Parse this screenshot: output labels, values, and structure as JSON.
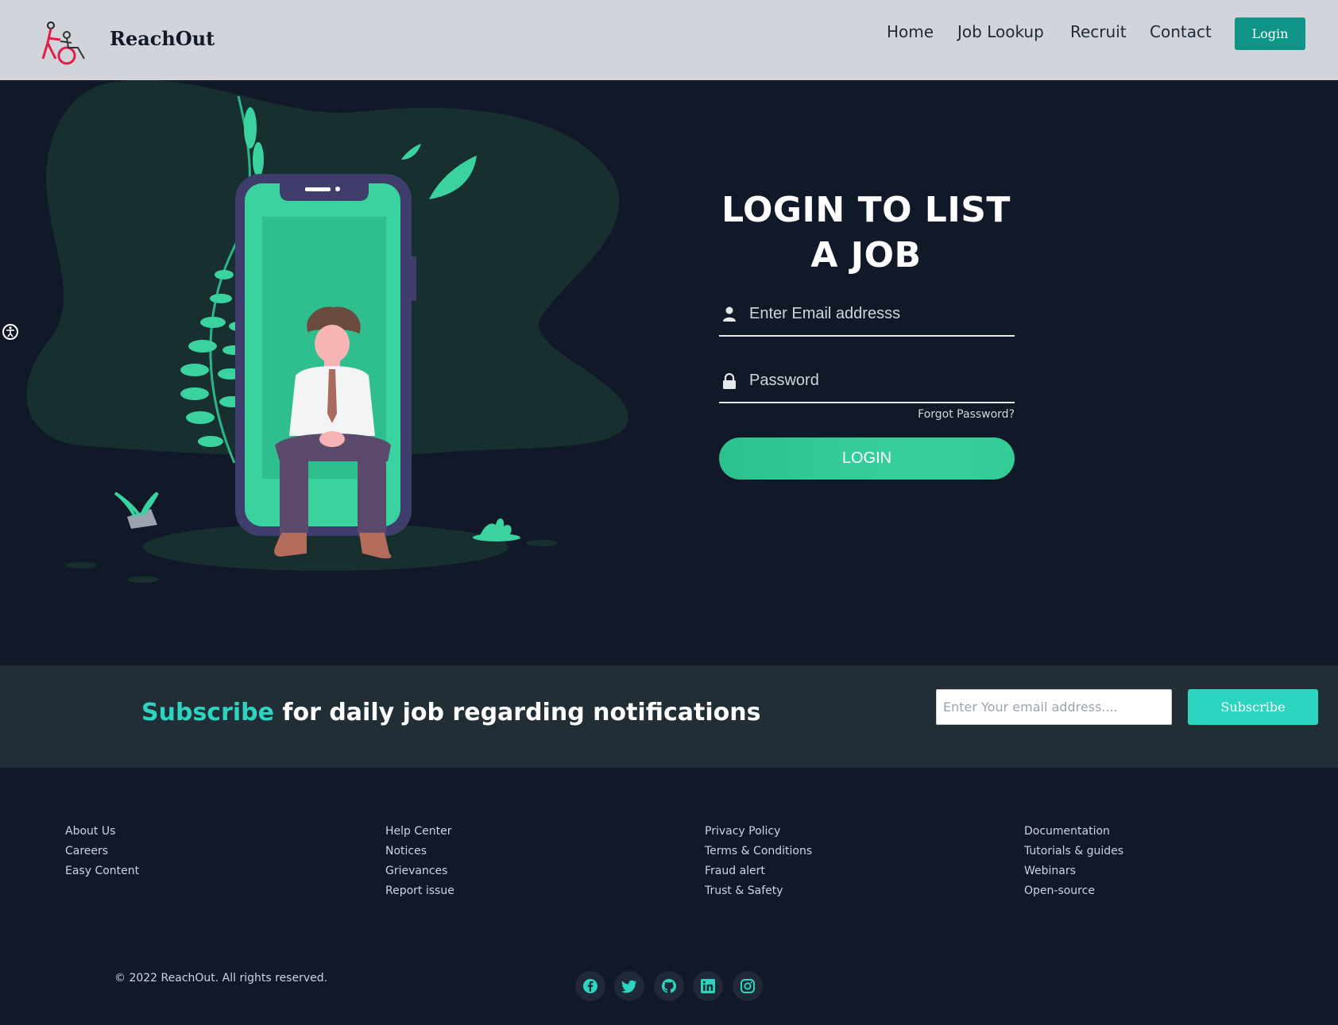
{
  "header": {
    "brand": "ReachOut",
    "nav": [
      "Home",
      "Job Lookup",
      "Recruit",
      "Contact"
    ],
    "login_label": "Login"
  },
  "hero": {
    "title": "LOGIN TO LIST A JOB",
    "email_placeholder": "Enter Email addresss",
    "password_placeholder": "Password",
    "forgot": "Forgot Password?",
    "login_button": "LOGIN"
  },
  "subscribe": {
    "accent": "Subscribe",
    "rest": " for daily job regarding notifications",
    "input_placeholder": "Enter Your email address....",
    "button": "Subscribe"
  },
  "footer": {
    "col1": [
      "About Us",
      "Careers",
      "Easy Content"
    ],
    "col2": [
      "Help Center",
      "Notices",
      "Grievances",
      "Report issue"
    ],
    "col3": [
      "Privacy Policy",
      "Terms & Conditions",
      "Fraud alert",
      "Trust & Safety"
    ],
    "col4": [
      "Documentation",
      "Tutorials & guides",
      "Webinars",
      "Open-source"
    ],
    "copyright": "© 2022 ReachOut. All rights reserved.",
    "social_icons": [
      "facebook-icon",
      "twitter-icon",
      "github-icon",
      "linkedin-icon",
      "instagram-icon"
    ]
  },
  "colors": {
    "header_bg": "#d1d5db",
    "page_bg": "#111827",
    "accent_teal": "#2dd4bf",
    "login_green": "#34cc97",
    "header_button": "#0f9488"
  }
}
